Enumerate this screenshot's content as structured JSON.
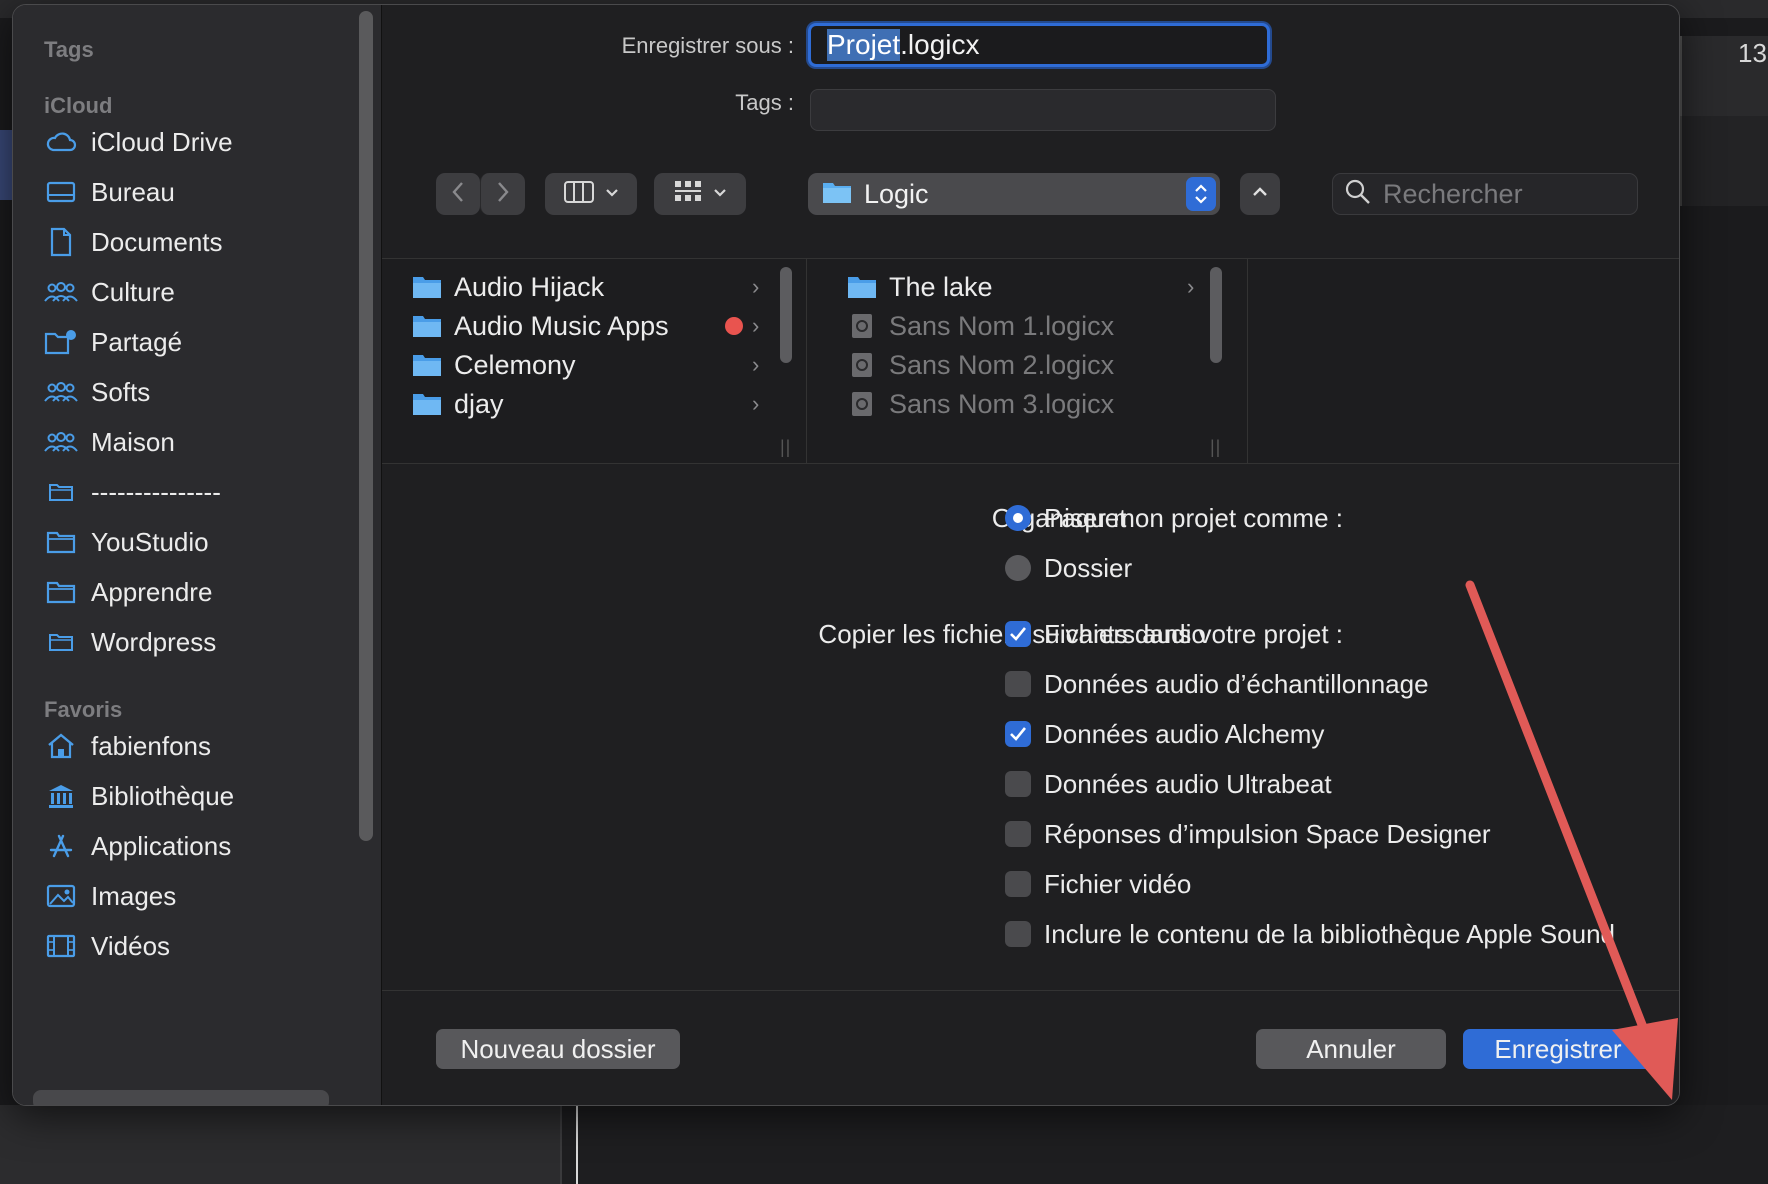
{
  "window": {
    "timeline_number": "13"
  },
  "sidebar": {
    "sections": {
      "tags": "Tags",
      "icloud": "iCloud",
      "favoris": "Favoris"
    },
    "icloud_items": [
      {
        "label": "iCloud Drive",
        "icon": "cloud-icon"
      },
      {
        "label": "Bureau",
        "icon": "desktop-icon"
      },
      {
        "label": "Documents",
        "icon": "document-icon"
      },
      {
        "label": "Culture",
        "icon": "shared-group-icon"
      },
      {
        "label": "Partagé",
        "icon": "shared-folder-icon"
      },
      {
        "label": "Softs",
        "icon": "shared-group-icon"
      },
      {
        "label": "Maison",
        "icon": "shared-group-icon"
      },
      {
        "label": "---------------",
        "icon": "folder-icon"
      },
      {
        "label": "YouStudio",
        "icon": "folder-icon"
      },
      {
        "label": "Apprendre",
        "icon": "folder-icon"
      },
      {
        "label": "Wordpress",
        "icon": "folder-icon"
      }
    ],
    "favoris_items": [
      {
        "label": "fabienfons",
        "icon": "home-icon"
      },
      {
        "label": "Bibliothèque",
        "icon": "library-icon"
      },
      {
        "label": "Applications",
        "icon": "applications-icon"
      },
      {
        "label": "Images",
        "icon": "images-icon"
      },
      {
        "label": "Vidéos",
        "icon": "film-icon"
      }
    ]
  },
  "save_form": {
    "save_as_label": "Enregistrer sous :",
    "filename_selected": "Projet",
    "filename_rest": ".logicx",
    "tags_label": "Tags :",
    "tags_value": ""
  },
  "toolbar": {
    "location": "Logic",
    "search_placeholder": "Rechercher"
  },
  "browser": {
    "column1": [
      {
        "name": "Audio Hijack",
        "has_tag": false
      },
      {
        "name": "Audio Music Apps",
        "has_tag": true
      },
      {
        "name": "Celemony",
        "has_tag": false
      },
      {
        "name": "djay",
        "has_tag": false
      }
    ],
    "column2": [
      {
        "name": "The lake",
        "kind": "folder"
      },
      {
        "name": "Sans Nom 1.logicx",
        "kind": "file"
      },
      {
        "name": "Sans Nom 2.logicx",
        "kind": "file"
      },
      {
        "name": "Sans Nom 3.logicx",
        "kind": "file"
      }
    ]
  },
  "options": {
    "organize_label": "Organiser mon projet comme :",
    "organize_options": [
      {
        "label": "Paquet",
        "selected": true
      },
      {
        "label": "Dossier",
        "selected": false
      }
    ],
    "copy_label": "Copier les fichiers suivants dans votre projet :",
    "copy_options": [
      {
        "label": "Fichiers audio",
        "checked": true
      },
      {
        "label": "Données audio d’échantillonnage",
        "checked": false
      },
      {
        "label": "Données audio Alchemy",
        "checked": true
      },
      {
        "label": "Données audio Ultrabeat",
        "checked": false
      },
      {
        "label": "Réponses d’impulsion Space Designer",
        "checked": false
      },
      {
        "label": "Fichier vidéo",
        "checked": false
      },
      {
        "label": "Inclure le contenu de la bibliothèque Apple Sound",
        "checked": false
      }
    ]
  },
  "footer": {
    "new_folder": "Nouveau dossier",
    "cancel": "Annuler",
    "save": "Enregistrer"
  },
  "colors": {
    "accent": "#2f6cd6",
    "tag_red": "#e9544f",
    "annotation_arrow": "#e05a57"
  }
}
